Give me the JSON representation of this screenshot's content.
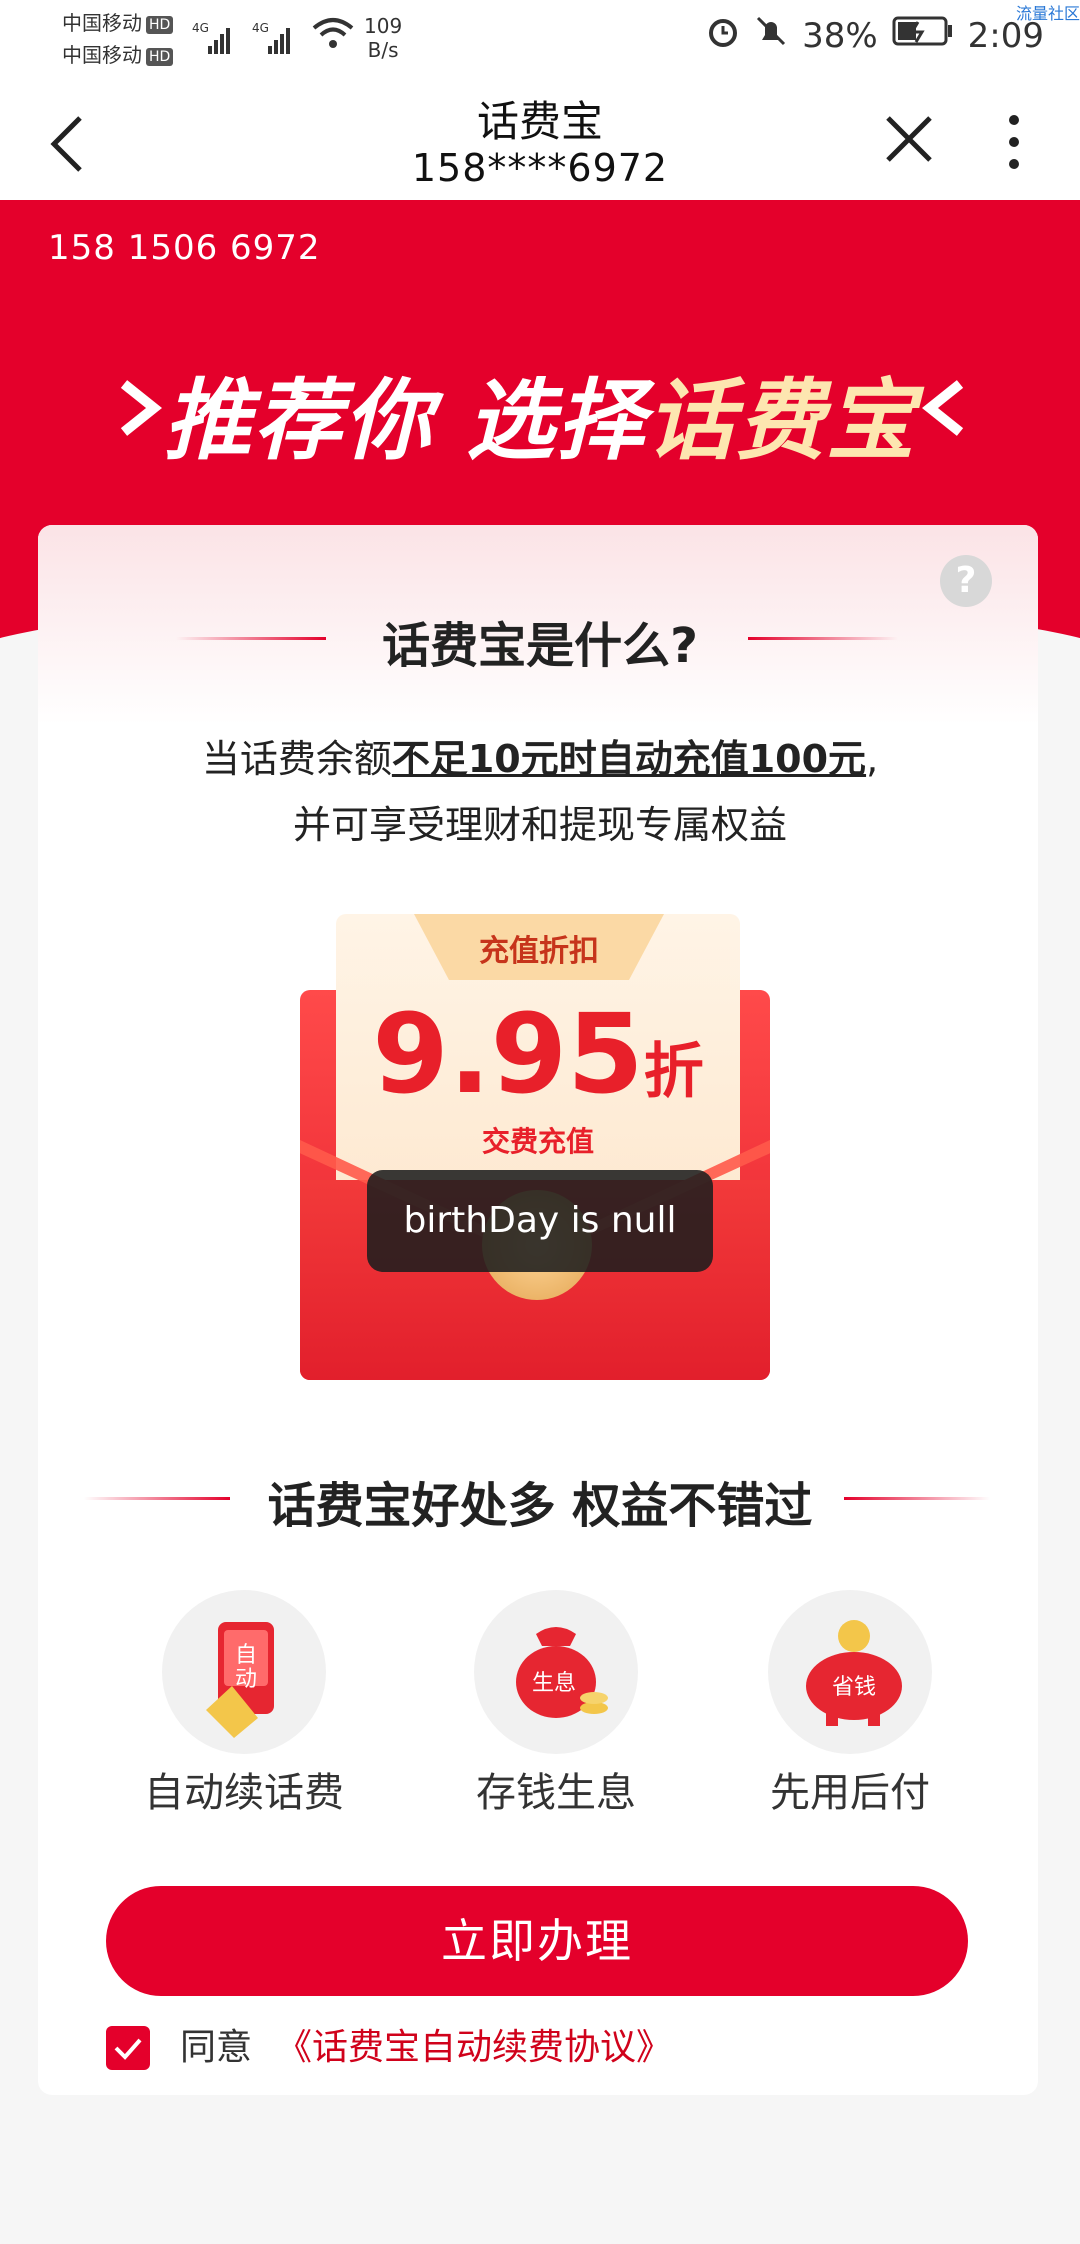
{
  "status": {
    "carrier1": "中国移动",
    "carrier2": "中国移动",
    "hd": "HD",
    "net": "4G",
    "speed_value": "109",
    "speed_unit": "B/s",
    "battery": "38%",
    "time": "2:09",
    "corner": "流量社区"
  },
  "nav": {
    "title": "话费宝",
    "subtitle": "158****6972"
  },
  "header": {
    "phone": "158 1506 6972",
    "slogan_a": "推荐你 选择",
    "slogan_b": "话费宝"
  },
  "card": {
    "help": "?",
    "title": "话费宝是什么?",
    "desc_pre": "当话费余额",
    "desc_bold": "不足10元时自动充值100元",
    "desc_post": ",",
    "desc_line2": "并可享受理财和提现专属权益"
  },
  "envelope": {
    "ribbon": "充值折扣",
    "discount": "9.95",
    "unit": "折",
    "sub": "交费充值"
  },
  "toast": "birthDay is null",
  "benefits": {
    "title": "话费宝好处多 权益不错过",
    "items": [
      {
        "label": "自动续话费",
        "icon_text": "自动"
      },
      {
        "label": "存钱生息",
        "icon_text": "生息"
      },
      {
        "label": "先用后付",
        "icon_text": "省钱"
      }
    ]
  },
  "cta": {
    "button": "立即办理",
    "agree": "同意",
    "agreement": "《话费宝自动续费协议》"
  },
  "colors": {
    "brand": "#e4002b",
    "highlight": "#fde6b0"
  }
}
